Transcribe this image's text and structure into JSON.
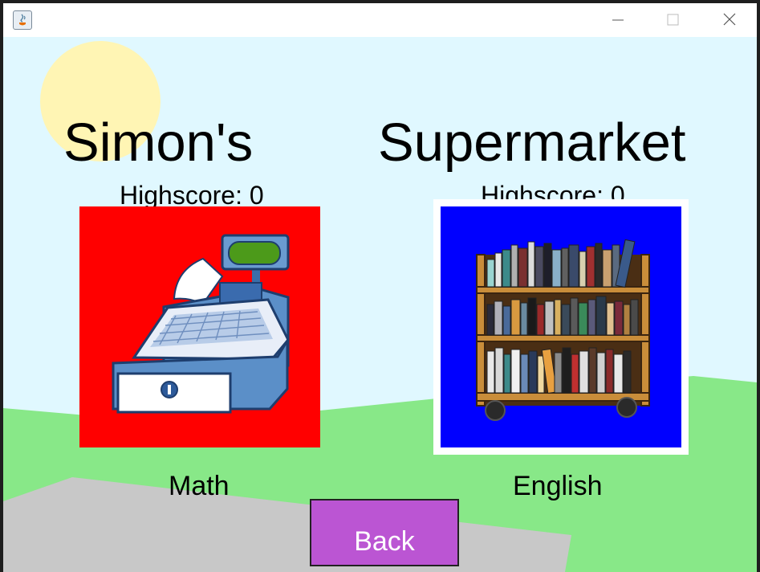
{
  "window": {
    "minimize_label": "—",
    "maximize_label": "☐",
    "close_label": "✕"
  },
  "game": {
    "title_left": "Simon's",
    "title_right": "Supermarket",
    "options": [
      {
        "label": "Math",
        "highscore": "Highscore: 0",
        "tile_color": "#ff0000",
        "icon": "cash-register-icon",
        "selected": false
      },
      {
        "label": "English",
        "highscore": "Highscore: 0",
        "tile_color": "#0000ff",
        "icon": "bookshelf-icon",
        "selected": true
      }
    ],
    "back_label": "Back"
  },
  "colors": {
    "sky": "#e0f8ff",
    "sun": "#fff5b4",
    "grass": "#88e888",
    "road": "#c8c8c8",
    "back_button": "#bb55d3"
  }
}
